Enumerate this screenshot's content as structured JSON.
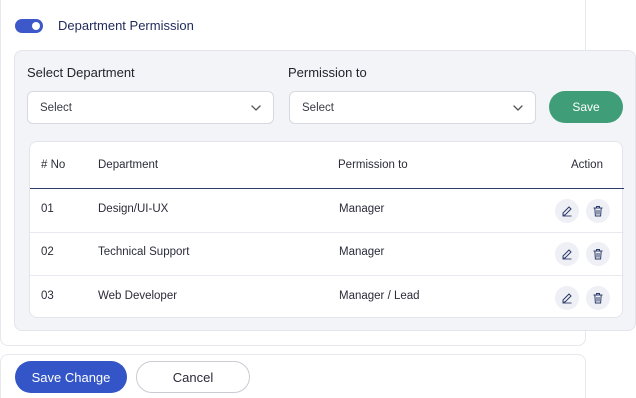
{
  "header": {
    "toggle_on": true,
    "title": "Department Permission"
  },
  "form": {
    "department_label": "Select Department",
    "department_value": "Select",
    "permission_label": "Permission to",
    "permission_value": "Select",
    "save_label": "Save"
  },
  "table": {
    "columns": [
      "# No",
      "Department",
      "Permission to",
      "Action"
    ],
    "rows": [
      {
        "no": "01",
        "department": "Design/UI-UX",
        "permission": "Manager"
      },
      {
        "no": "02",
        "department": "Technical Support",
        "permission": "Manager"
      },
      {
        "no": "03",
        "department": "Web Developer",
        "permission": "Manager / Lead"
      }
    ],
    "row_icons": [
      "edit-icon",
      "trash-icon"
    ]
  },
  "footer": {
    "save_change_label": "Save Change",
    "cancel_label": "Cancel"
  },
  "colors": {
    "primary": "#3355c7",
    "success": "#3f9e77",
    "panel": "#f3f4f7"
  }
}
